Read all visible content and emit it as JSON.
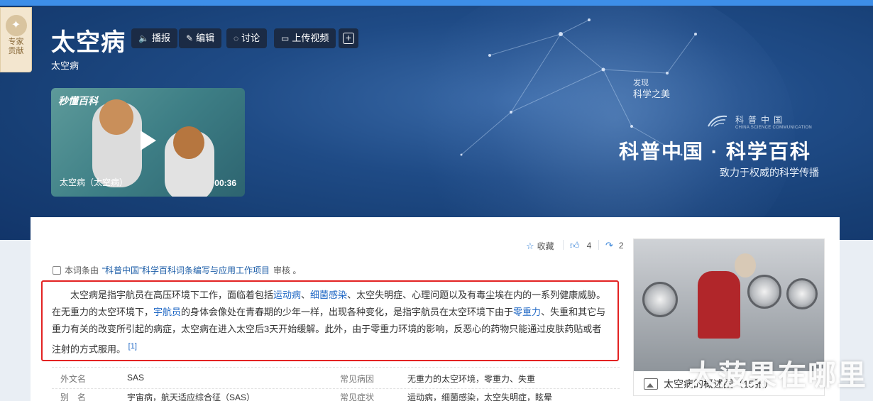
{
  "expert_badge": {
    "label": "专家贡献"
  },
  "entry": {
    "title": "太空病",
    "subtitle": "太空病"
  },
  "toolbar": {
    "broadcast": "播报",
    "edit": "编辑",
    "discuss": "讨论",
    "upload_video": "上传视频"
  },
  "video": {
    "logo": "秒懂百科",
    "caption": "太空病（太空病）",
    "duration": "00:36"
  },
  "brand": {
    "discover": "发现",
    "discover_sub": "科学之美",
    "cn_name": "科普中国",
    "en_name": "CHINA SCIENCE COMMUNICATION",
    "main": "科普中国 · 科学百科",
    "slogan": "致力于权威的科学传播"
  },
  "actions": {
    "favorite": "收藏",
    "likes": "4",
    "shares": "2"
  },
  "review": {
    "prefix": "本词条由",
    "link": "“科普中国”科学百科词条编写与应用工作项目",
    "suffix": "审核 。"
  },
  "summary": {
    "p1": "太空病是指宇航员在高压环境下工作，面临着包括",
    "link1": "运动病",
    "sep1": "、",
    "link2": "细菌感染",
    "p2": "、太空失明症、心理问题以及有毒尘埃在内的一系列健康威胁。在无重力的太空环境下，",
    "link3": "宇航员",
    "p3": "的身体会像处在青春期的少年一样，出现各种变化，是指宇航员在太空环境下由于",
    "link4": "零重力",
    "p4": "、失重和其它与重力有关的改变所引起的病症，太空病在进入太空后3天开始缓解。此外，由于零重力环境的影响，反恶心的药物只能通过皮肤药贴或者注射的方式服用。",
    "ref": "[1]"
  },
  "info": [
    {
      "k1": "外文名",
      "v1": "SAS",
      "k2": "常见病因",
      "v2": "无重力的太空环境，零重力、失重"
    },
    {
      "k1": "别　名",
      "v1": "宇宙病，航天适应综合征（SAS）",
      "k2": "常见症状",
      "v2": "运动病，细菌感染，太空失明症，眩晕"
    }
  ],
  "album": {
    "caption": "太空病的概述图（15张）"
  },
  "watermark": "大菠果在哪里"
}
